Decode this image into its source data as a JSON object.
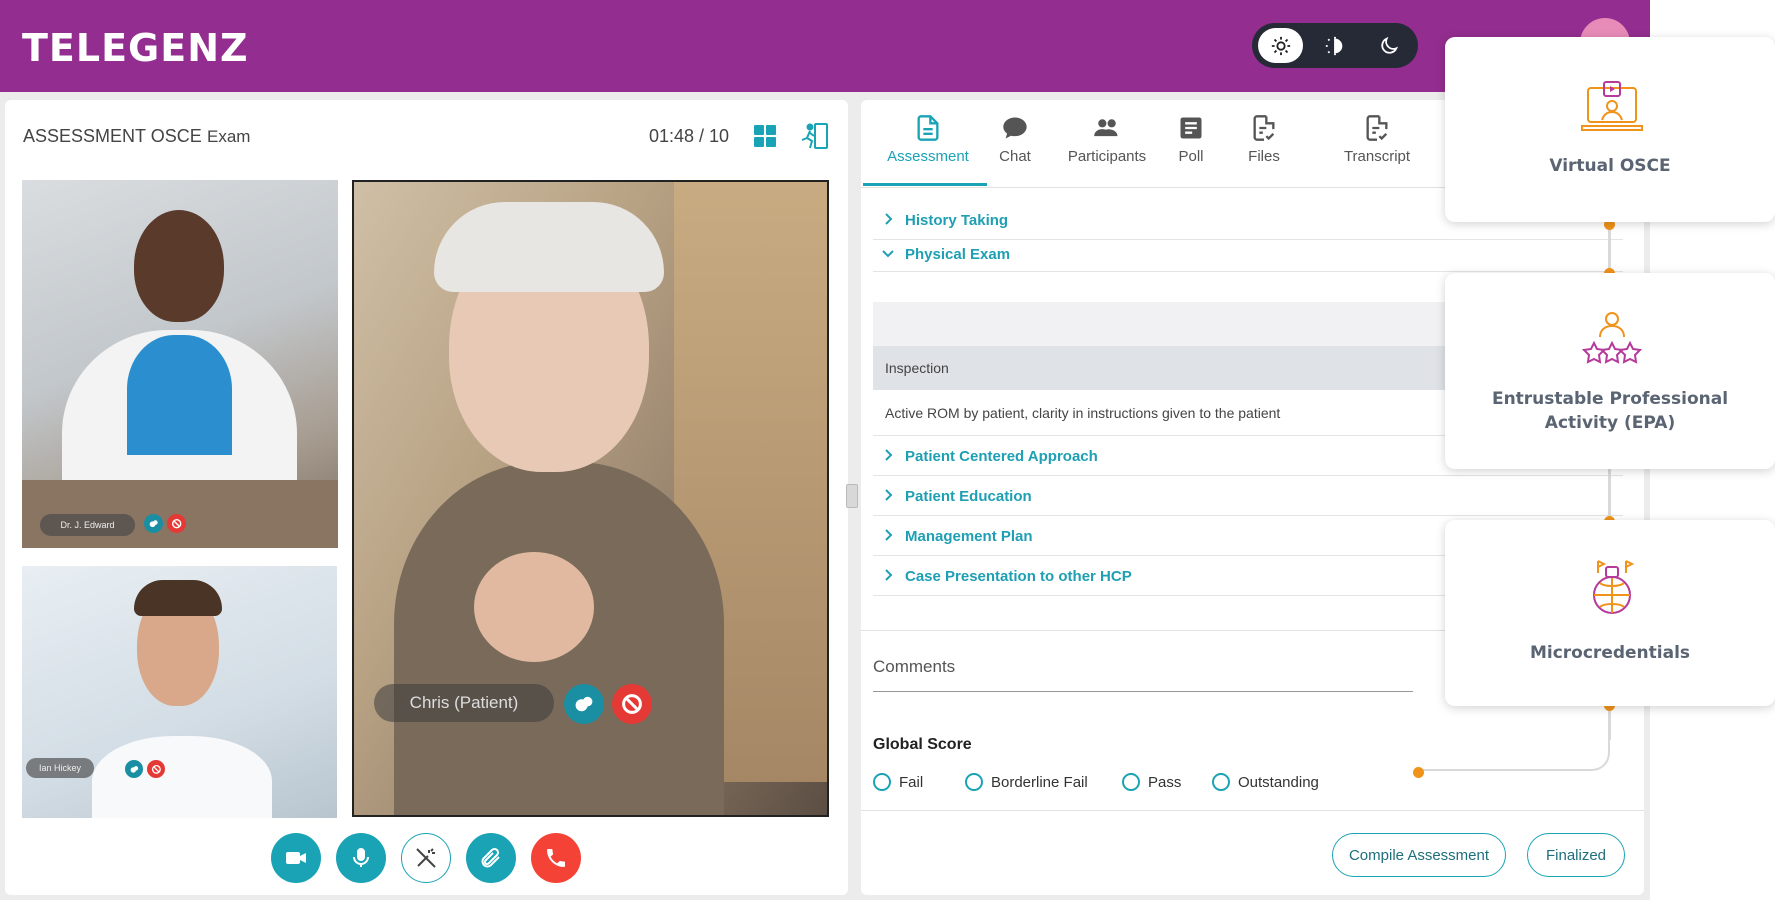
{
  "brand": {
    "logo_text": "TELEGENZ"
  },
  "theme_modes": [
    {
      "name": "light",
      "active": true
    },
    {
      "name": "auto",
      "active": false
    },
    {
      "name": "dark",
      "active": false
    }
  ],
  "video": {
    "title": "ASSESSMENT OSCE",
    "subtitle": "Exam",
    "timer": "01:48 / 10",
    "participants": [
      {
        "name": "Dr. J. Edward"
      },
      {
        "name": "Ian Hickey"
      },
      {
        "name": "Chris (Patient)"
      }
    ],
    "controls": [
      "camera",
      "microphone",
      "effects",
      "attachment",
      "end-call"
    ]
  },
  "tabs": [
    {
      "label": "Assessment",
      "icon": "document-icon",
      "active": true
    },
    {
      "label": "Chat",
      "icon": "chat-icon"
    },
    {
      "label": "Participants",
      "icon": "people-icon"
    },
    {
      "label": "Poll",
      "icon": "poll-icon"
    },
    {
      "label": "Files",
      "icon": "files-icon"
    },
    {
      "label": "Transcript",
      "icon": "transcript-icon"
    }
  ],
  "assessment": {
    "sections": [
      {
        "label": "History Taking",
        "expanded": false
      },
      {
        "label": "Physical Exam",
        "expanded": true
      },
      {
        "label": "Patient Centered Approach",
        "expanded": false
      },
      {
        "label": "Patient Education",
        "expanded": false
      },
      {
        "label": "Management Plan",
        "expanded": false
      },
      {
        "label": "Case Presentation to other HCP",
        "expanded": false
      }
    ],
    "physical_exam": {
      "item_title": "Inspection",
      "item_detail": "Active ROM by patient, clarity in instructions given to the patient"
    },
    "comments_placeholder": "Comments",
    "global_score": {
      "title": "Global Score",
      "options": [
        "Fail",
        "Borderline Fail",
        "Pass",
        "Outstanding"
      ]
    },
    "buttons": {
      "compile": "Compile Assessment",
      "finalized": "Finalized"
    }
  },
  "feature_cards": [
    {
      "title": "Virtual OSCE",
      "icon": "virtual-osce-icon"
    },
    {
      "title": "Entrustable Professional Activity (EPA)",
      "icon": "epa-icon"
    },
    {
      "title": "Microcredentials",
      "icon": "microcredentials-icon"
    }
  ],
  "colors": {
    "brand_purple": "#932d8f",
    "accent_teal": "#1aa3b5",
    "timeline_orange": "#f0931a",
    "end_call_red": "#f44336"
  }
}
